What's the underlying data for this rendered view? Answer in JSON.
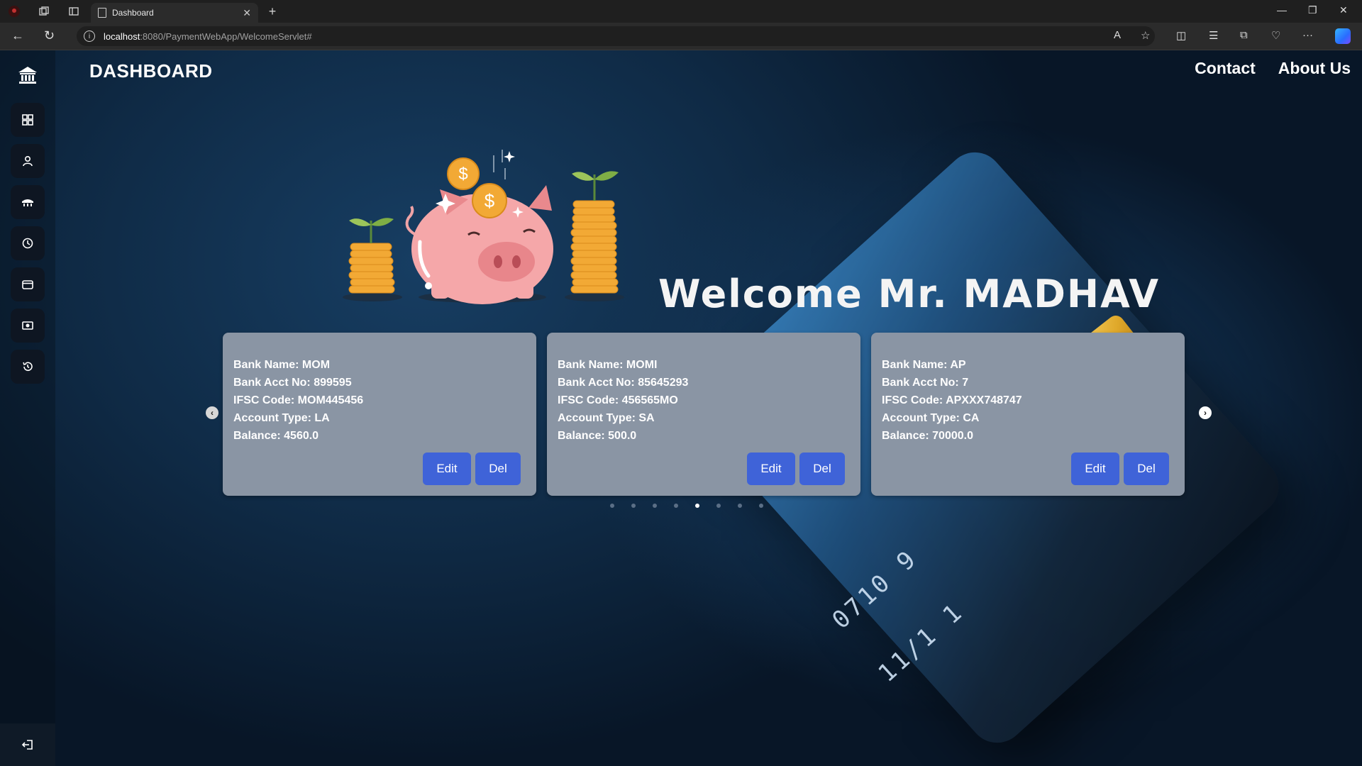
{
  "browser": {
    "tab_title": "Dashboard",
    "url_host": "localhost",
    "url_path": ":8080/PaymentWebApp/WelcomeServlet#"
  },
  "header": {
    "title": "DASHBOARD",
    "nav": [
      "Contact",
      "About Us"
    ]
  },
  "welcome_text": "Welcome Mr. MADHAV",
  "sidebar": {
    "items": [
      {
        "icon": "grid-icon"
      },
      {
        "icon": "user-icon"
      },
      {
        "icon": "bank-icon"
      },
      {
        "icon": "clock-icon"
      },
      {
        "icon": "wallet-icon"
      },
      {
        "icon": "money-icon"
      },
      {
        "icon": "history-icon"
      }
    ],
    "logout_icon": "logout-icon"
  },
  "accounts": [
    {
      "bank_name": "Bank Name: MOM",
      "acct_no": "Bank Acct No: 899595",
      "ifsc": "IFSC Code: MOM445456",
      "type": "Account Type: LA",
      "balance": "Balance: 4560.0",
      "edit_label": "Edit",
      "del_label": "Del"
    },
    {
      "bank_name": "Bank Name: MOMI",
      "acct_no": "Bank Acct No: 85645293",
      "ifsc": "IFSC Code: 456565MO",
      "type": "Account Type: SA",
      "balance": "Balance: 500.0",
      "edit_label": "Edit",
      "del_label": "Del"
    },
    {
      "bank_name": "Bank Name: AP",
      "acct_no": "Bank Acct No: 7",
      "ifsc": "IFSC Code: APXXX748747",
      "type": "Account Type: CA",
      "balance": "Balance: 70000.0",
      "edit_label": "Edit",
      "del_label": "Del"
    }
  ],
  "carousel": {
    "dot_count": 8,
    "active_index": 4
  },
  "colors": {
    "card_bg": "#8a95a4",
    "button_bg": "#3f63d8",
    "page_bg": "#0f2a45"
  }
}
